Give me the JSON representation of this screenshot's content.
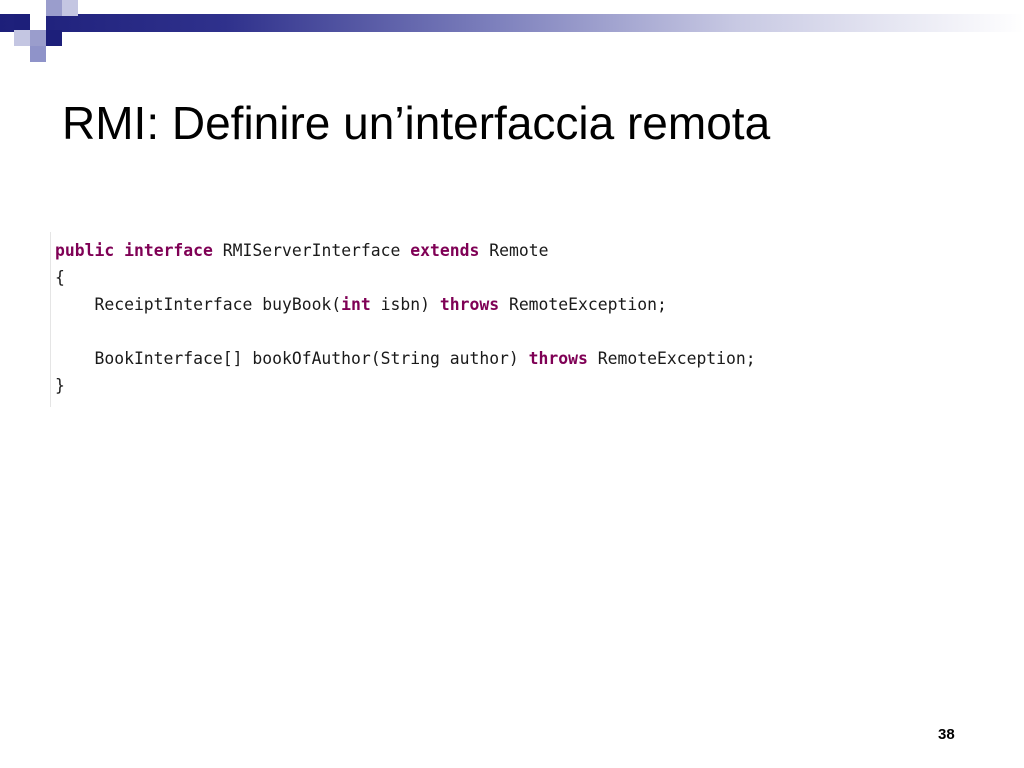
{
  "slide": {
    "title": "RMI: Definire un’interfaccia remota",
    "page_number": "38"
  },
  "theme": {
    "accent_dark": "#1d1f7a",
    "accent_light": "#8f93c9",
    "keyword_color": "#7f0055"
  },
  "code": {
    "language": "Java",
    "lines": [
      {
        "pre": "",
        "kw1": "public",
        "mid1": " ",
        "kw2": "interface",
        "mid2": " RMIServerInterface ",
        "kw3": "extends",
        "post": " Remote"
      },
      {
        "pre": "{",
        "kw1": "",
        "mid1": "",
        "kw2": "",
        "mid2": "",
        "kw3": "",
        "post": ""
      },
      {
        "pre": "    ReceiptInterface buyBook(",
        "kw1": "int",
        "mid1": " isbn) ",
        "kw2": "throws",
        "mid2": " RemoteException;",
        "kw3": "",
        "post": ""
      },
      {
        "pre": "",
        "kw1": "",
        "mid1": "",
        "kw2": "",
        "mid2": "",
        "kw3": "",
        "post": ""
      },
      {
        "pre": "    BookInterface[] bookOfAuthor(String author) ",
        "kw1": "throws",
        "mid1": " RemoteException;",
        "kw2": "",
        "mid2": "",
        "kw3": "",
        "post": ""
      },
      {
        "pre": "}",
        "kw1": "",
        "mid1": "",
        "kw2": "",
        "mid2": "",
        "kw3": "",
        "post": ""
      }
    ]
  }
}
